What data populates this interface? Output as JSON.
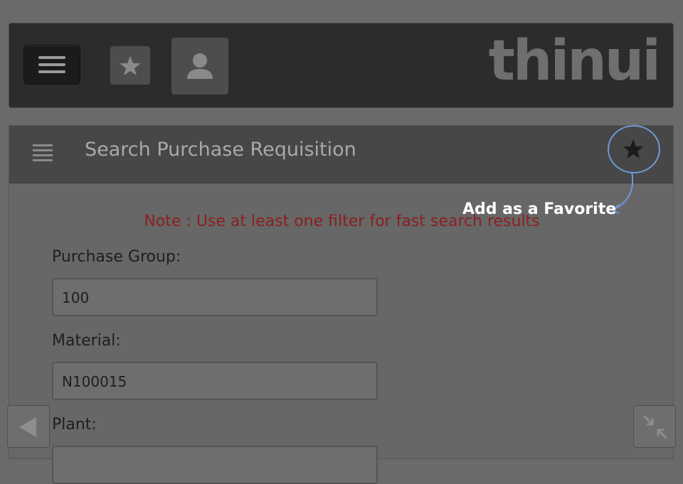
{
  "header": {
    "logo_text": "thinui",
    "menu_icon": "menu-icon",
    "favorites_icon": "star-icon",
    "user_icon": "user-icon"
  },
  "panel": {
    "title": "Search Purchase Requisition",
    "list_icon": "list-icon",
    "favorite_icon": "star-icon"
  },
  "callout": {
    "text": "Add as a Favorite",
    "color": "#6d9ad6"
  },
  "note": {
    "text": "Note : Use at least one filter for fast search results",
    "color": "#8b1f1f"
  },
  "form": {
    "purchase_group_label": "Purchase Group:",
    "purchase_group_value": "100",
    "material_label": "Material:",
    "material_value": "N100015",
    "plant_label": "Plant:",
    "plant_value": ""
  },
  "footer": {
    "back_icon": "back-arrow-icon",
    "collapse_icon": "collapse-icon"
  }
}
